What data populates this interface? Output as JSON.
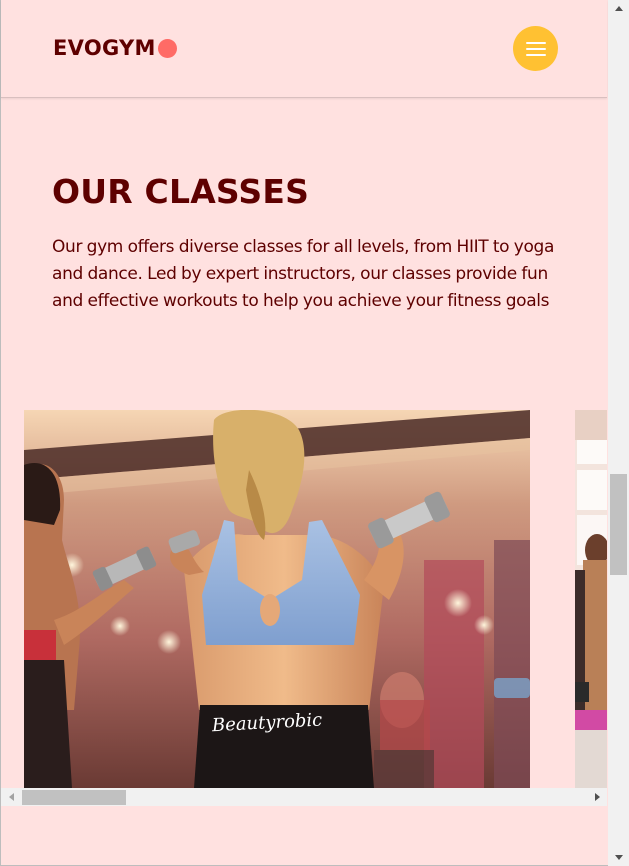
{
  "header": {
    "logo_text": "EVOGYM",
    "logo_dot_color": "#ff6b66",
    "menu_button_icon": "hamburger-menu-icon",
    "menu_button_color": "#ffc132"
  },
  "classes_section": {
    "title": "OUR CLASSES",
    "description": "Our gym offers diverse classes for all levels, from HIIT to yoga and dance. Led by expert instructors, our classes provide fun and effective workouts to help you achieve your fitness goals",
    "cards": [
      {
        "image": "women-lifting-dumbbells-photo",
        "shirt_text": "Beautyrobic"
      },
      {
        "image": "class-photo-partial"
      }
    ]
  },
  "colors": {
    "background": "#ffe1e0",
    "primary_text": "#5e0000",
    "accent": "#ffc132",
    "secondary": "#ff6b66"
  }
}
